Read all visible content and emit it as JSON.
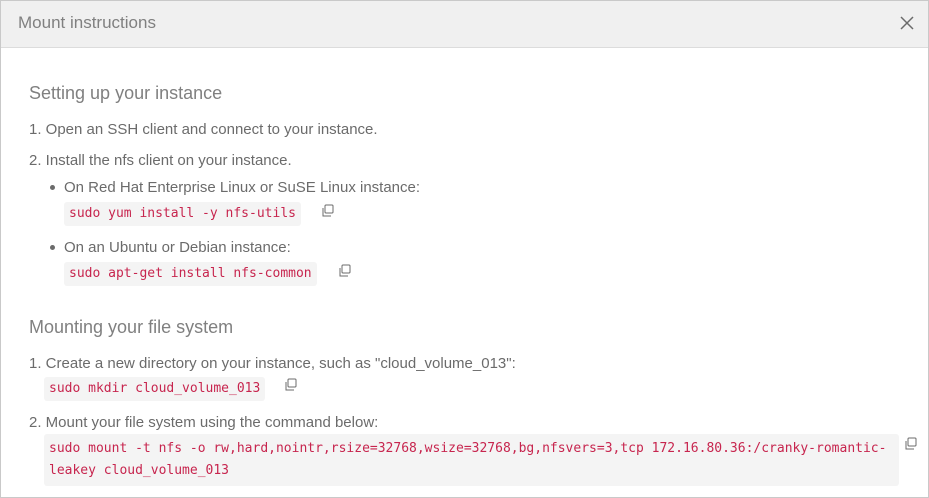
{
  "dialog": {
    "title": "Mount instructions"
  },
  "setup": {
    "heading": "Setting up your instance",
    "step1": "1. Open an SSH client and connect to your instance.",
    "step2": "2. Install the nfs client on your instance.",
    "bullets": [
      {
        "label": "On Red Hat Enterprise Linux or SuSE Linux instance:",
        "command": "sudo yum install -y nfs-utils"
      },
      {
        "label": "On an Ubuntu or Debian instance:",
        "command": "sudo apt-get install nfs-common"
      }
    ]
  },
  "mount": {
    "heading": "Mounting your file system",
    "step1": "1. Create a new directory on your instance, such as \"cloud_volume_013\":",
    "step1_command": "sudo mkdir cloud_volume_013",
    "step2": "2. Mount your file system using the command below:",
    "step2_command": "sudo mount -t nfs -o rw,hard,nointr,rsize=32768,wsize=32768,bg,nfsvers=3,tcp 172.16.80.36:/cranky-romantic-leakey cloud_volume_013"
  },
  "icons": {
    "close": "close-icon",
    "copy": "copy-icon"
  },
  "colors": {
    "code_text": "#c7254e",
    "code_bg": "#f4f4f4",
    "header_bg": "#f0f0f0"
  }
}
